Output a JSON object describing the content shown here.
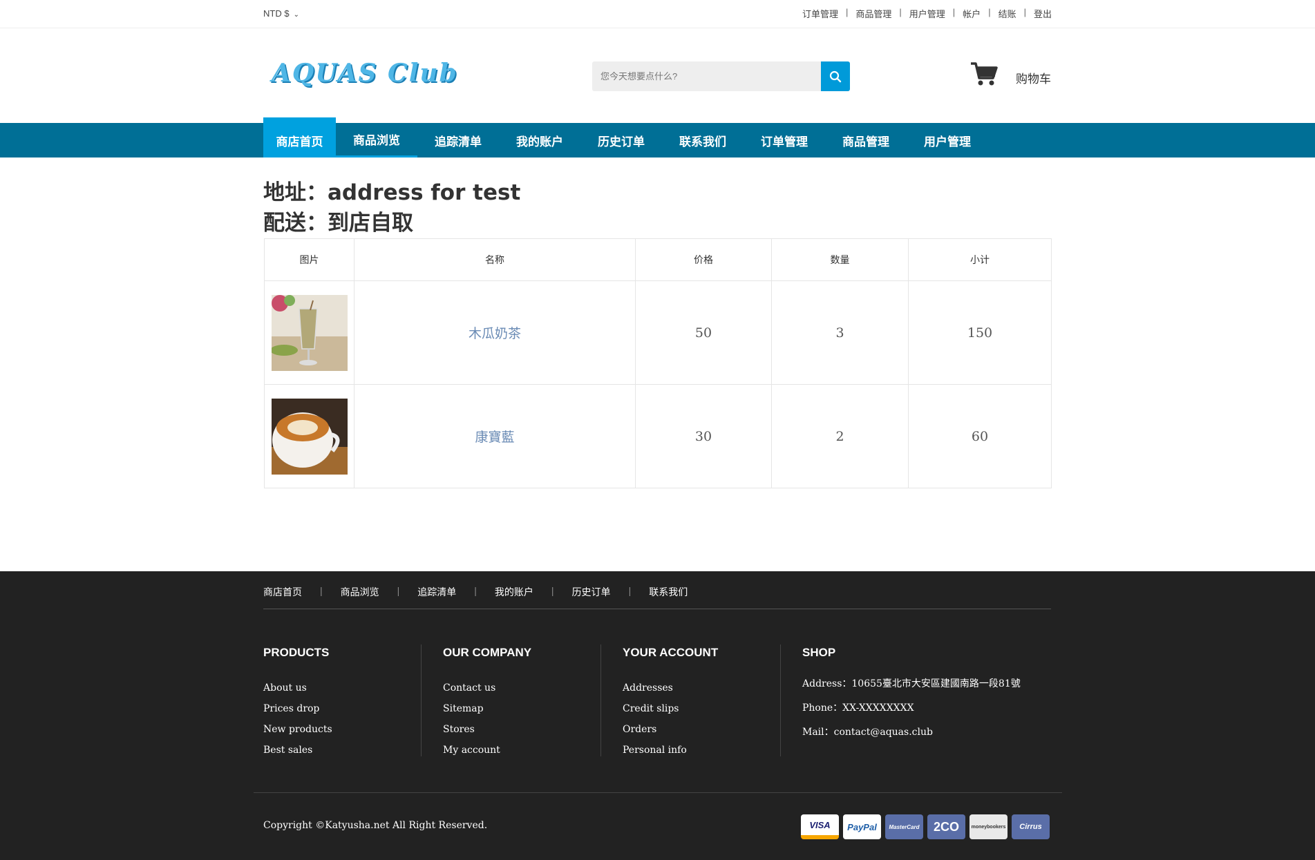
{
  "topbar": {
    "currency": "NTD $",
    "links": [
      "订单管理",
      "商品管理",
      "用户管理",
      "帐户",
      "结账",
      "登出"
    ]
  },
  "header": {
    "logo": "AQUAS Club",
    "search_placeholder": "您今天想要点什么?",
    "cart_label": "购物车"
  },
  "nav": {
    "items": [
      "商店首页",
      "商品浏览",
      "追踪清单",
      "我的账户",
      "历史订单",
      "联系我们",
      "订单管理",
      "商品管理",
      "用户管理"
    ]
  },
  "order": {
    "address_line": "地址：address for test",
    "delivery_line": "配送：到店自取",
    "columns": [
      "图片",
      "名称",
      "价格",
      "数量",
      "小计"
    ],
    "rows": [
      {
        "name": "木瓜奶茶",
        "price": "50",
        "qty": "3",
        "subtotal": "150",
        "image": "papaya-milk-tea"
      },
      {
        "name": "康寶藍",
        "price": "30",
        "qty": "2",
        "subtotal": "60",
        "image": "latte-cup"
      }
    ]
  },
  "footer": {
    "nav": [
      "商店首页",
      "商品浏览",
      "追踪清单",
      "我的账户",
      "历史订单",
      "联系我们"
    ],
    "columns": [
      {
        "title": "PRODUCTS",
        "links": [
          "About us",
          "Prices drop",
          "New products",
          "Best sales"
        ]
      },
      {
        "title": "OUR COMPANY",
        "links": [
          "Contact us",
          "Sitemap",
          "Stores",
          "My account"
        ]
      },
      {
        "title": "YOUR ACCOUNT",
        "links": [
          "Addresses",
          "Credit slips",
          "Orders",
          "Personal info"
        ]
      },
      {
        "title": "SHOP",
        "links": [
          "Address：10655臺北市大安區建國南路一段81號",
          "Phone：XX-XXXXXXXX",
          "Mail：contact@aquas.club"
        ]
      }
    ],
    "copyright": "Copyright ©Katyusha.net All Right Reserved.",
    "payments": [
      "VISA",
      "PayPal",
      "MasterCard",
      "2CO",
      "moneybookers",
      "Cirrus"
    ]
  },
  "colors": {
    "nav_bg": "#006f96",
    "accent": "#00a1df",
    "footer_bg": "#222222"
  }
}
